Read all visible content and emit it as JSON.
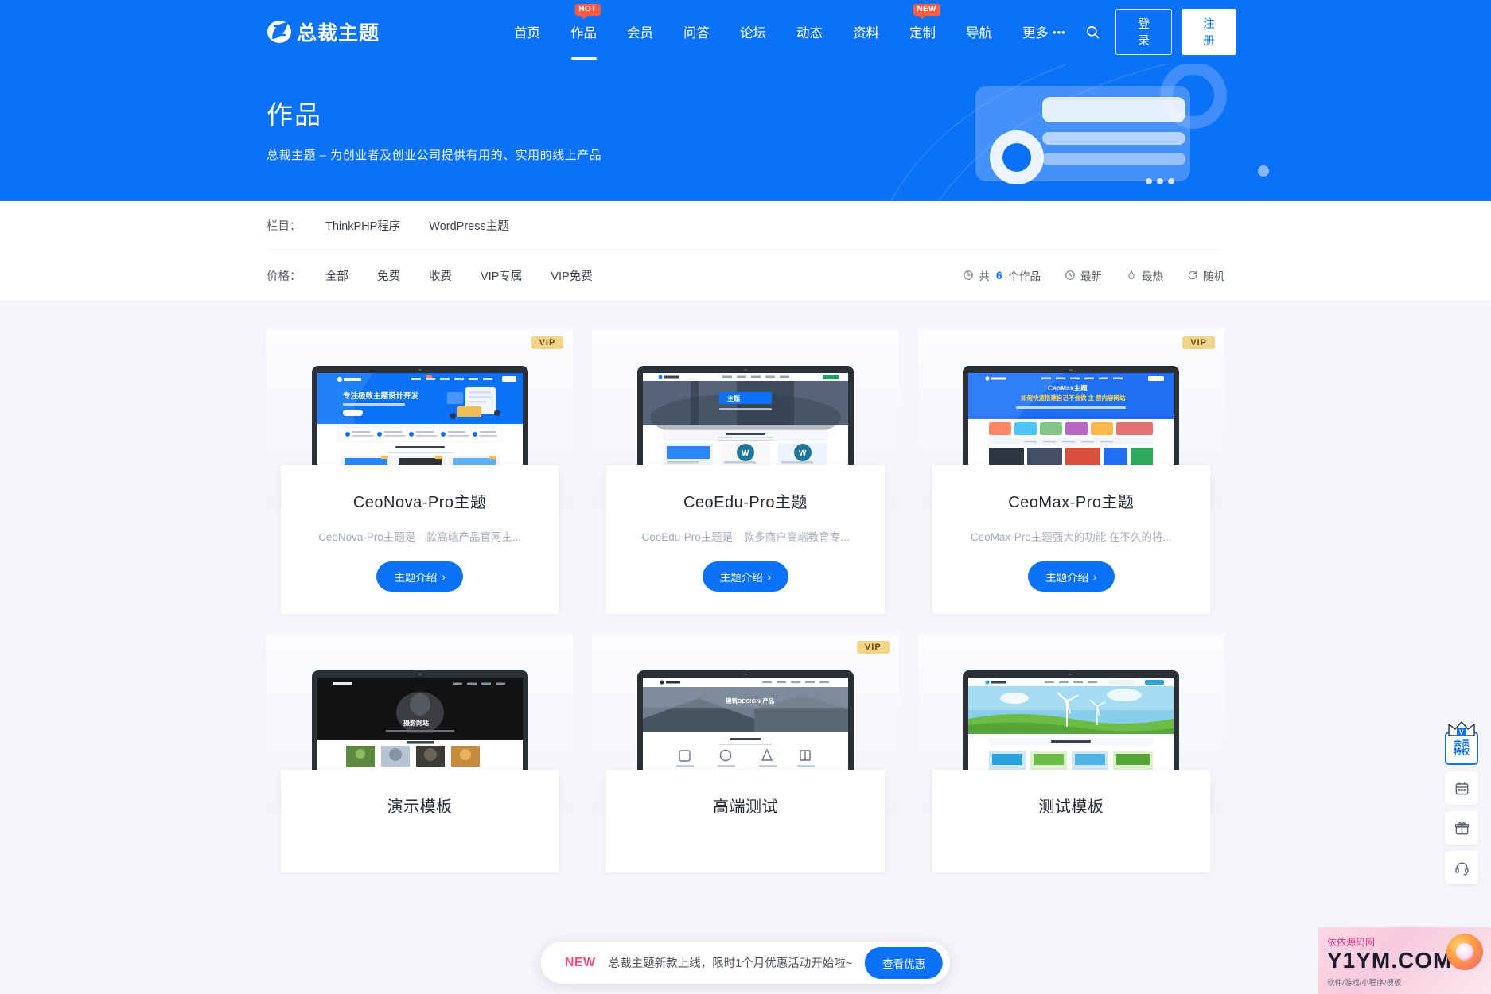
{
  "header": {
    "logo_text": "总裁主题",
    "logo_icon": "z-logo-icon",
    "nav": [
      {
        "label": "首页",
        "badge": null,
        "active": false
      },
      {
        "label": "作品",
        "badge": "HOT",
        "active": true
      },
      {
        "label": "会员",
        "badge": null,
        "active": false
      },
      {
        "label": "问答",
        "badge": null,
        "active": false
      },
      {
        "label": "论坛",
        "badge": null,
        "active": false
      },
      {
        "label": "动态",
        "badge": null,
        "active": false
      },
      {
        "label": "资料",
        "badge": null,
        "active": false
      },
      {
        "label": "定制",
        "badge": "NEW",
        "active": false
      },
      {
        "label": "导航",
        "badge": null,
        "active": false
      },
      {
        "label": "更多",
        "badge": null,
        "active": false,
        "dots": "•••"
      }
    ],
    "search_icon": "search-icon",
    "login_label": "登录",
    "register_label": "注册"
  },
  "hero": {
    "title": "作品",
    "subtitle": "总裁主题 – 为创业者及创业公司提供有用的、实用的线上产品"
  },
  "filters": {
    "category_label": "栏目：",
    "categories": [
      "ThinkPHP程序",
      "WordPress主题"
    ],
    "price_label": "价格：",
    "prices": [
      "全部",
      "免费",
      "收费",
      "VIP专属",
      "VIP免费"
    ],
    "sorts": [
      {
        "icon": "pie-chart-icon",
        "prefix": "共",
        "count": "6",
        "suffix": "个作品"
      },
      {
        "icon": "clock-icon",
        "label": "最新"
      },
      {
        "icon": "fire-icon",
        "label": "最热"
      },
      {
        "icon": "refresh-icon",
        "label": "随机"
      }
    ]
  },
  "cards": [
    {
      "title": "CeoNova-Pro主题",
      "desc": "CeoNova-Pro主题是—款高端产品官网主...",
      "button": "主题介绍",
      "vip": "VIP",
      "shot": "ceonova-preview"
    },
    {
      "title": "CeoEdu-Pro主题",
      "desc": "CeoEdu-Pro主题是—款多商户高端教育专...",
      "button": "主题介绍",
      "vip": null,
      "shot": "ceoedu-preview"
    },
    {
      "title": "CeoMax-Pro主题",
      "desc": "CeoMax-Pro主题强大的功能 在不久的将...",
      "button": "主题介绍",
      "vip": "VIP",
      "shot": "ceomax-preview"
    },
    {
      "title": "演示模板",
      "desc": "",
      "button": "",
      "vip": null,
      "shot": "photo-dark-preview"
    },
    {
      "title": "高端测试",
      "desc": "",
      "button": "",
      "vip": "VIP",
      "shot": "architecture-preview"
    },
    {
      "title": "测试模板",
      "desc": "",
      "button": "",
      "vip": null,
      "shot": "green-energy-preview"
    }
  ],
  "side_widgets": [
    {
      "name": "vip-privilege",
      "line1": "会员",
      "line2": "特权",
      "icon": "crown-icon"
    },
    {
      "name": "calendar",
      "icon": "calendar-icon"
    },
    {
      "name": "gift",
      "icon": "gift-icon"
    },
    {
      "name": "support",
      "icon": "headset-icon"
    }
  ],
  "notice": {
    "tag": "NEW",
    "text": "总裁主题新款上线，限时1个月优惠活动开始啦~",
    "button": "查看优惠"
  },
  "watermark": {
    "sub": "依依源码网",
    "main": "Y1YM.COM",
    "foot": "软件/游戏/小程序/模板"
  },
  "colors": {
    "brand": "#0b72f7",
    "badge_hot": "#ff5b47",
    "vip_gold": "#f3d28a",
    "notice_new": "#f2507a"
  }
}
